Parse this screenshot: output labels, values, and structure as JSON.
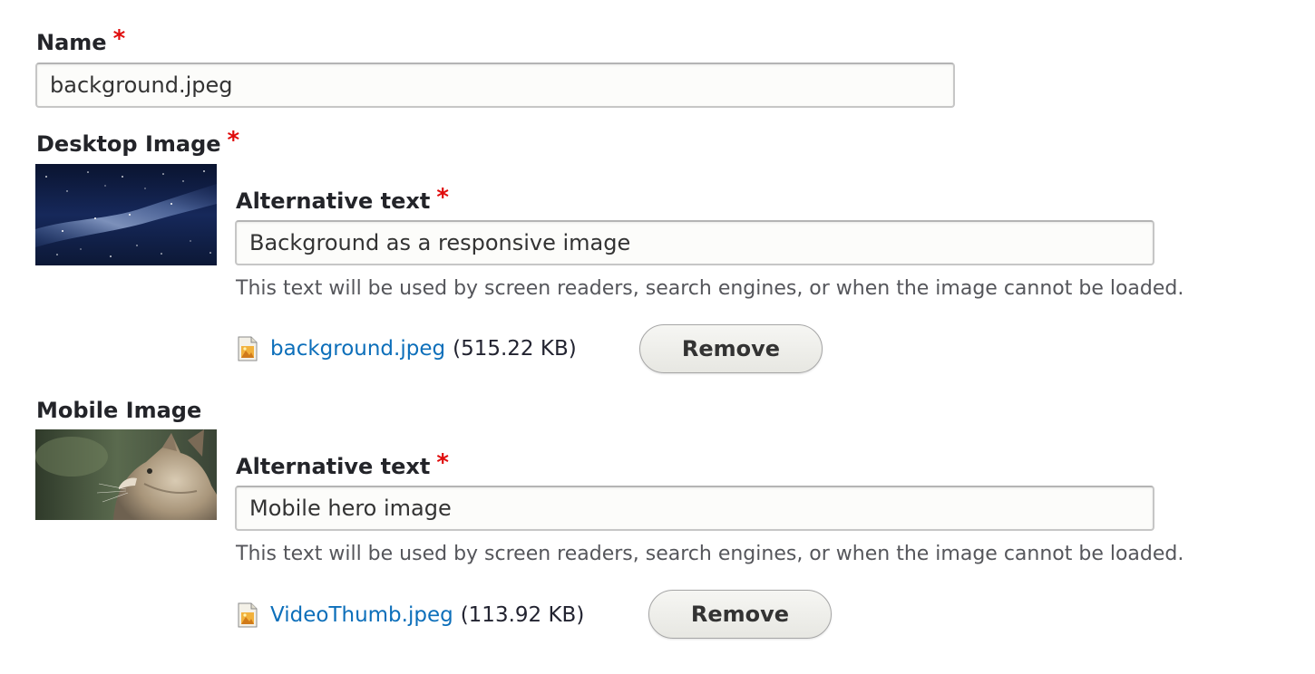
{
  "name_field": {
    "label": "Name",
    "required_marker": "*",
    "value": "background.jpeg"
  },
  "desktop_image": {
    "label": "Desktop Image",
    "required_marker": "*",
    "alt_label": "Alternative text",
    "alt_required_marker": "*",
    "alt_value": "Background as a responsive image",
    "alt_description": "This text will be used by screen readers, search engines, or when the image cannot be loaded.",
    "file_name": "background.jpeg",
    "file_size": "(515.22 KB)",
    "remove_label": "Remove"
  },
  "mobile_image": {
    "label": "Mobile Image",
    "alt_label": "Alternative text",
    "alt_required_marker": "*",
    "alt_value": "Mobile hero image",
    "alt_description": "This text will be used by screen readers, search engines, or when the image cannot be loaded.",
    "file_name": "VideoThumb.jpeg",
    "file_size": "(113.92 KB)",
    "remove_label": "Remove"
  },
  "colors": {
    "required": "#e00c0c",
    "link": "#0d6fba",
    "label": "#232429",
    "description": "#55565b"
  },
  "icons": {
    "file": "image-file-icon"
  }
}
